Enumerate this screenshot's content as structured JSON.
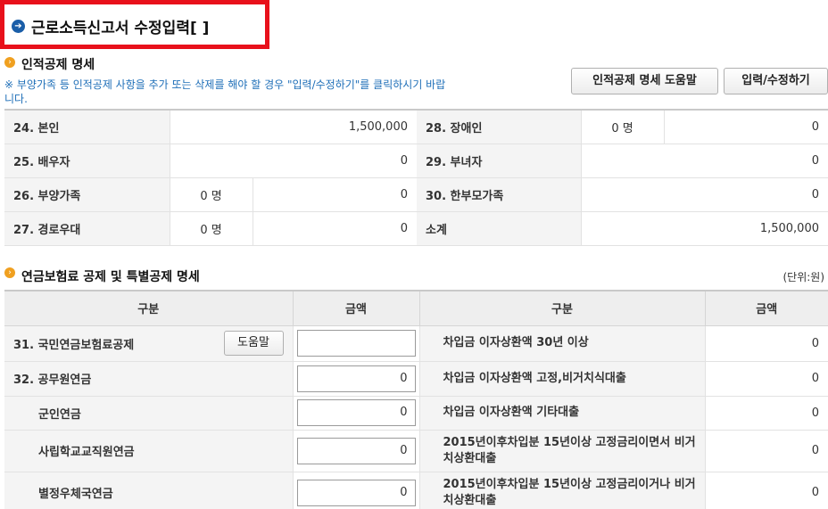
{
  "page": {
    "title": "근로소득신고서 수정입력[       ]"
  },
  "personal": {
    "section_title": "인적공제 명세",
    "notice": "※ 부양가족 등 인적공제 사항을 추가 또는 삭제를 해야 할 경우 \"입력/수정하기\"를 클릭하시기 바랍니다.",
    "help_button": "인적공제 명세 도움말",
    "edit_button": "입력/수정하기",
    "rows": [
      {
        "left_label": "24. 본인",
        "left_count": "",
        "left_value": "1,500,000",
        "right_label": "28. 장애인",
        "right_count": "0  명",
        "right_value": "0"
      },
      {
        "left_label": "25. 배우자",
        "left_count": "",
        "left_value": "0",
        "right_label": "29. 부녀자",
        "right_count": "",
        "right_value": "0"
      },
      {
        "left_label": "26. 부양가족",
        "left_count": "0  명",
        "left_value": "0",
        "right_label": "30. 한부모가족",
        "right_count": "",
        "right_value": "0"
      },
      {
        "left_label": "27. 경로우대",
        "left_count": "0  명",
        "left_value": "0",
        "right_label": "소계",
        "right_count": "",
        "right_value": "1,500,000"
      }
    ]
  },
  "pension": {
    "section_title": "연금보험료 공제 및 특별공제 명세",
    "unit": "(단위:원)",
    "headers": [
      "구분",
      "금액",
      "구분",
      "금액"
    ],
    "help_button": "도움말",
    "rows": [
      {
        "label": "31. 국민연금보험료공제",
        "input": "",
        "right_label": "차입금 이자상환액 30년 이상",
        "right_value": "0"
      },
      {
        "label": "32. 공무원연금",
        "input": "0",
        "right_label": "차입금 이자상환액 고정,비거치식대출",
        "right_value": "0"
      },
      {
        "label": "군인연금",
        "input": "0",
        "right_label": "차입금 이자상환액 기타대출",
        "right_value": "0"
      },
      {
        "label": "사립학교교직원연금",
        "input": "0",
        "right_label": "2015년이후차입분 15년이상 고정금리이면서 비거치상환대출",
        "right_value": "0"
      },
      {
        "label": "별정우체국연금",
        "input": "0",
        "right_label": "2015년이후차입분 15년이상 고정금리이거나 비거치상환대출",
        "right_value": "0"
      }
    ]
  }
}
